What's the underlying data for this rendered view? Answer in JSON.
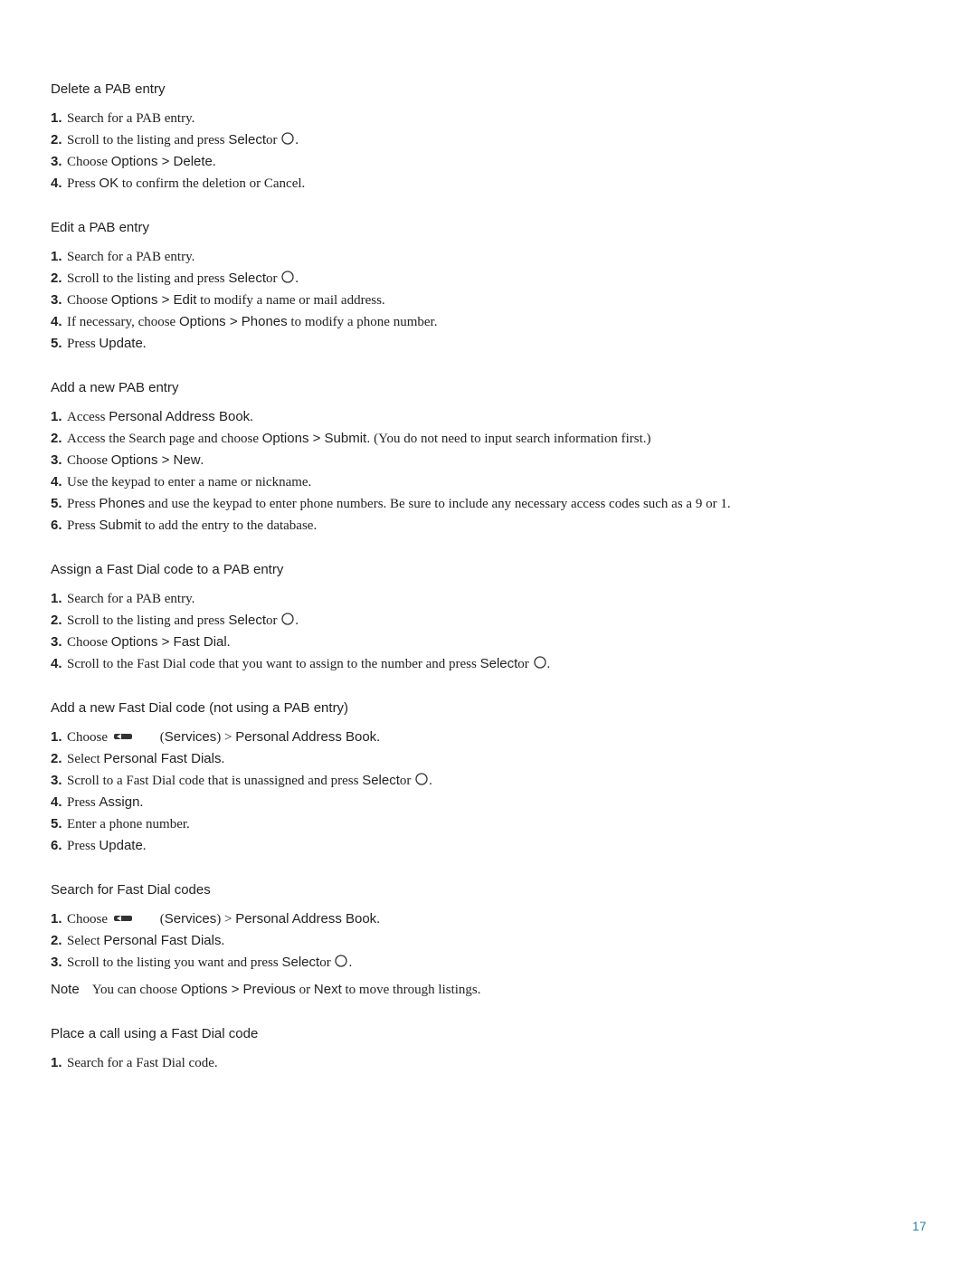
{
  "page_number": "17",
  "sections": {
    "delete_pab": {
      "heading": "Delete a PAB entry",
      "step1_pre": "Search for a PAB entry.",
      "step2_pre": "Scroll to the listing and press ",
      "step2_ui": "Select",
      "step2_post_ui": "or ",
      "step2_end": ".",
      "step3_pre": "Choose ",
      "step3_ui": "Options > Delete",
      "step3_end": ".",
      "step4_pre": "Press ",
      "step4_ui": "OK",
      "step4_post": " to confirm the deletion or Cancel."
    },
    "edit_pab": {
      "heading": "Edit a PAB entry",
      "step1_pre": "Search for a PAB entry.",
      "step2_pre": "Scroll to the listing and press ",
      "step2_ui": "Select",
      "step2_post_ui": "or ",
      "step2_end": ".",
      "step3_pre": "Choose ",
      "step3_ui": "Options > Edit",
      "step3_post": " to modify a name or mail address.",
      "step4_pre": "If necessary, choose ",
      "step4_ui": "Options > Phones",
      "step4_post": " to modify a phone number.",
      "step5_pre": "Press ",
      "step5_ui": "Update",
      "step5_end": "."
    },
    "add_pab": {
      "heading": "Add a new PAB entry",
      "step1_pre": "Access ",
      "step1_ui": "Personal Address Book",
      "step1_end": ".",
      "step2_pre": "Access the Search page and choose ",
      "step2_ui": "Options > Submit.",
      "step2_post": " (You do not need to input search information first.)",
      "step3_pre": "Choose ",
      "step3_ui": "Options > New",
      "step3_end": ".",
      "step4_pre": "Use the keypad to enter a name or nickname.",
      "step5_pre": "Press ",
      "step5_ui": "Phones",
      "step5_post": " and use the keypad to enter phone numbers. Be sure to include any necessary access codes such as a 9 or 1.",
      "step6_pre": "Press ",
      "step6_ui": "Submit",
      "step6_post": " to add the entry to the database."
    },
    "assign_fastdial": {
      "heading": "Assign a Fast Dial code to a PAB entry",
      "step1_pre": "Search for a PAB entry.",
      "step2_pre": "Scroll to the listing and press ",
      "step2_ui": "Select",
      "step2_post_ui": "or ",
      "step2_end": ".",
      "step3_pre": "Choose ",
      "step3_ui": "Options > Fast Dial",
      "step3_end": ".",
      "step4_pre": "Scroll to the Fast Dial code that you want to assign to the number and press ",
      "step4_ui": "Select",
      "step4_post_ui": "or ",
      "step4_end": "."
    },
    "add_fastdial": {
      "heading": "Add a new Fast Dial code (not using a PAB entry)",
      "step1_pre": "Choose ",
      "step1_ui1_open": "(",
      "step1_ui1": "Services",
      "step1_ui1_close": ")",
      "step1_mid": " > ",
      "step1_ui2": "Personal Address Book",
      "step1_end": ".",
      "step2_pre": "Select ",
      "step2_ui": "Personal Fast Dials",
      "step2_end": ".",
      "step3_pre": "Scroll to a Fast Dial code that is unassigned and press ",
      "step3_ui": "Select",
      "step3_post_ui": "or ",
      "step3_end": ".",
      "step4_pre": "Press ",
      "step4_ui": "Assign",
      "step4_end": ".",
      "step5_pre": "Enter a phone number.",
      "step6_pre": "Press ",
      "step6_ui": "Update",
      "step6_end": "."
    },
    "search_fastdial": {
      "heading": "Search for Fast Dial codes",
      "step1_pre": "Choose ",
      "step1_ui1_open": "(",
      "step1_ui1": "Services",
      "step1_ui1_close": ")",
      "step1_mid": " > ",
      "step1_ui2": "Personal Address Book",
      "step1_end": ".",
      "step2_pre": "Select ",
      "step2_ui": "Personal Fast Dials",
      "step2_end": ".",
      "step3_pre": "Scroll to the listing you want and press ",
      "step3_ui": "Select",
      "step3_post_ui": "or ",
      "step3_end": ".",
      "note_label": "Note",
      "note_pre": "You can choose ",
      "note_ui1": "Options > Previous",
      "note_mid": " or ",
      "note_ui2": "Next",
      "note_post": " to move through listings."
    },
    "place_call": {
      "heading": "Place a call using a Fast Dial code",
      "step1_pre": "Search for a Fast Dial code."
    }
  }
}
